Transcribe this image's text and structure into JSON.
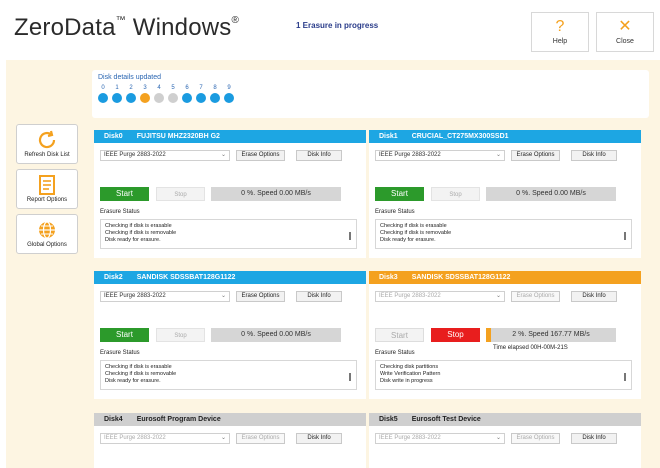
{
  "app": {
    "title": "ZeroData",
    "tm": "™",
    "title2": "Windows",
    "reg": "®",
    "status": "1 Erasure in progress",
    "help_label": "Help",
    "close_label": "Close",
    "help_glyph": "?",
    "close_glyph": "✕"
  },
  "details": {
    "title": "Disk details updated",
    "dots": [
      {
        "n": "0",
        "state": "blue"
      },
      {
        "n": "1",
        "state": "blue"
      },
      {
        "n": "2",
        "state": "blue"
      },
      {
        "n": "3",
        "state": "orange"
      },
      {
        "n": "4",
        "state": "gray"
      },
      {
        "n": "5",
        "state": "gray"
      },
      {
        "n": "6",
        "state": "blue"
      },
      {
        "n": "7",
        "state": "blue"
      },
      {
        "n": "8",
        "state": "blue"
      },
      {
        "n": "9",
        "state": "blue"
      }
    ]
  },
  "sidebar": {
    "refresh": "Refresh Disk List",
    "report": "Report Options",
    "global": "Global Options"
  },
  "colors": {
    "blue": "#1da6e3",
    "orange": "#f4a11f",
    "green": "#2c9a2b",
    "red": "#e81e1e",
    "gray": "#cfcfcf"
  },
  "disks": [
    {
      "id": "Disk0",
      "model": "FUJITSU MHZ2320BH G2",
      "header": "blue",
      "method": "IEEE Purge 2883-2022",
      "erase_options": "Erase Options",
      "disk_info": "Disk Info",
      "start": "Start",
      "stop": "Stop",
      "progress_text": "0 %. Speed 0.00 MB/s",
      "progress": 0,
      "erasure_label": "Erasure Status",
      "log": [
        "Checking if disk is erasable",
        "Checking if disk is removable",
        "Disk ready for erasure."
      ]
    },
    {
      "id": "Disk1",
      "model": "CRUCIAL_CT275MX300SSD1",
      "header": "blue",
      "method": "IEEE Purge 2883-2022",
      "erase_options": "Erase Options",
      "disk_info": "Disk Info",
      "start": "Start",
      "stop": "Stop",
      "progress_text": "0 %. Speed 0.00 MB/s",
      "progress": 0,
      "erasure_label": "Erasure Status",
      "log": [
        "Checking if disk is erasable",
        "Checking if disk is removable",
        "Disk ready for erasure."
      ]
    },
    {
      "id": "Disk2",
      "model": "SANDISK SDSSBAT128G1122",
      "header": "blue",
      "method": "IEEE Purge 2883-2022",
      "erase_options": "Erase Options",
      "disk_info": "Disk Info",
      "start": "Start",
      "stop": "Stop",
      "progress_text": "0 %. Speed 0.00 MB/s",
      "progress": 0,
      "erasure_label": "Erasure Status",
      "log": [
        "Checking if disk is erasable",
        "Checking if disk is removable",
        "Disk ready for erasure."
      ]
    },
    {
      "id": "Disk3",
      "model": "SANDISK SDSSBAT128G1122",
      "header": "orange",
      "method": "IEEE Purge 2883-2022",
      "erase_options": "Erase Options",
      "disk_info": "Disk Info",
      "start": "Start",
      "stop": "Stop",
      "progress_text": "2 %. Speed 167.77 MB/s",
      "progress": 2,
      "elapsed": "Time elapsed 00H-00M-21S",
      "erasure_label": "Erasure Status",
      "log": [
        "Checking disk partitions",
        "Write Verification Pattern",
        "Disk write in progress"
      ]
    },
    {
      "id": "Disk4",
      "model": "Eurosoft Program Device",
      "header": "gray",
      "method": "IEEE Purge 2883-2022",
      "erase_options": "Erase Options",
      "disk_info": "Disk Info"
    },
    {
      "id": "Disk5",
      "model": "Eurosoft Test Device",
      "header": "gray",
      "method": "IEEE Purge 2883-2022",
      "erase_options": "Erase Options",
      "disk_info": "Disk Info"
    }
  ]
}
